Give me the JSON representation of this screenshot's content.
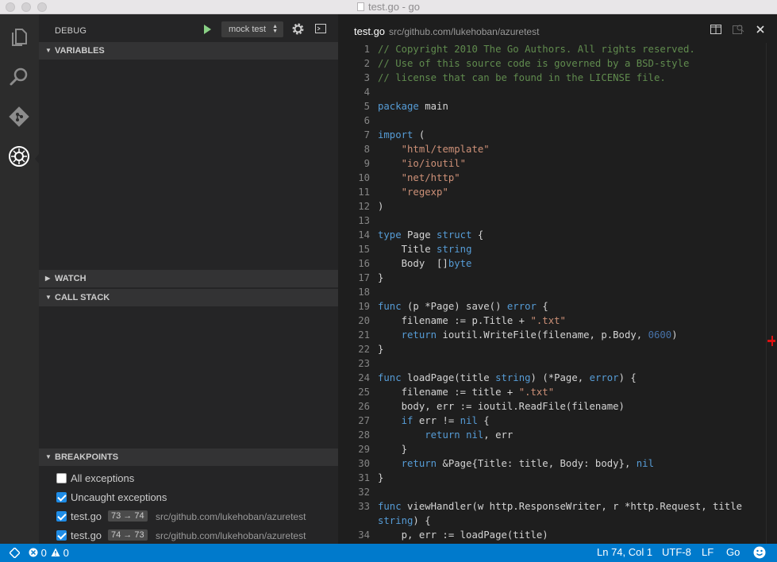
{
  "window": {
    "title": "test.go - go"
  },
  "activity_bar": {
    "items": [
      {
        "icon": "files-icon"
      },
      {
        "icon": "search-icon"
      },
      {
        "icon": "git-icon"
      },
      {
        "icon": "debug-icon"
      }
    ]
  },
  "debug_panel": {
    "title": "DEBUG",
    "config_selected": "mock test",
    "sections": {
      "variables": "VARIABLES",
      "watch": "WATCH",
      "call_stack": "CALL STACK",
      "breakpoints": "BREAKPOINTS"
    },
    "breakpoints": [
      {
        "label": "All exceptions",
        "checked": false
      },
      {
        "label": "Uncaught exceptions",
        "checked": true
      },
      {
        "label": "test.go",
        "badge": "73 → 74",
        "path": "src/github.com/lukehoban/azuretest",
        "checked": true
      },
      {
        "label": "test.go",
        "badge": "74 → 73",
        "path": "src/github.com/lukehoban/azuretest",
        "checked": true
      }
    ]
  },
  "editor": {
    "filename": "test.go",
    "path": "src/github.com/lukehoban/azuretest",
    "line_numbers": [
      "1",
      "2",
      "3",
      "4",
      "5",
      "6",
      "7",
      "8",
      "9",
      "10",
      "11",
      "12",
      "13",
      "14",
      "15",
      "16",
      "17",
      "18",
      "19",
      "20",
      "21",
      "22",
      "23",
      "24",
      "25",
      "26",
      "27",
      "28",
      "29",
      "30",
      "31",
      "32",
      "33",
      "",
      "34"
    ],
    "lines": [
      "// Copyright 2010 The Go Authors. All rights reserved.",
      "// Use of this source code is governed by a BSD-style",
      "// license that can be found in the LICENSE file.",
      "",
      "package main",
      "",
      "import (",
      "    \"html/template\"",
      "    \"io/ioutil\"",
      "    \"net/http\"",
      "    \"regexp\"",
      ")",
      "",
      "type Page struct {",
      "    Title string",
      "    Body  []byte",
      "}",
      "",
      "func (p *Page) save() error {",
      "    filename := p.Title + \".txt\"",
      "    return ioutil.WriteFile(filename, p.Body, 0600)",
      "}",
      "",
      "func loadPage(title string) (*Page, error) {",
      "    filename := title + \".txt\"",
      "    body, err := ioutil.ReadFile(filename)",
      "    if err != nil {",
      "        return nil, err",
      "    }",
      "    return &Page{Title: title, Body: body}, nil",
      "}",
      "",
      "func viewHandler(w http.ResponseWriter, r *http.Request, title",
      "string) {",
      "    p, err := loadPage(title)"
    ]
  },
  "statusbar": {
    "errors": "0",
    "warnings": "0",
    "cursor": "Ln 74, Col 1",
    "encoding": "UTF-8",
    "eol": "LF",
    "language": "Go"
  },
  "colors": {
    "accent": "#007acc",
    "comment": "#608b4e",
    "keyword": "#569cd6",
    "string": "#ce9178",
    "checkbox": "#1e8ce6",
    "play": "#89d185"
  }
}
